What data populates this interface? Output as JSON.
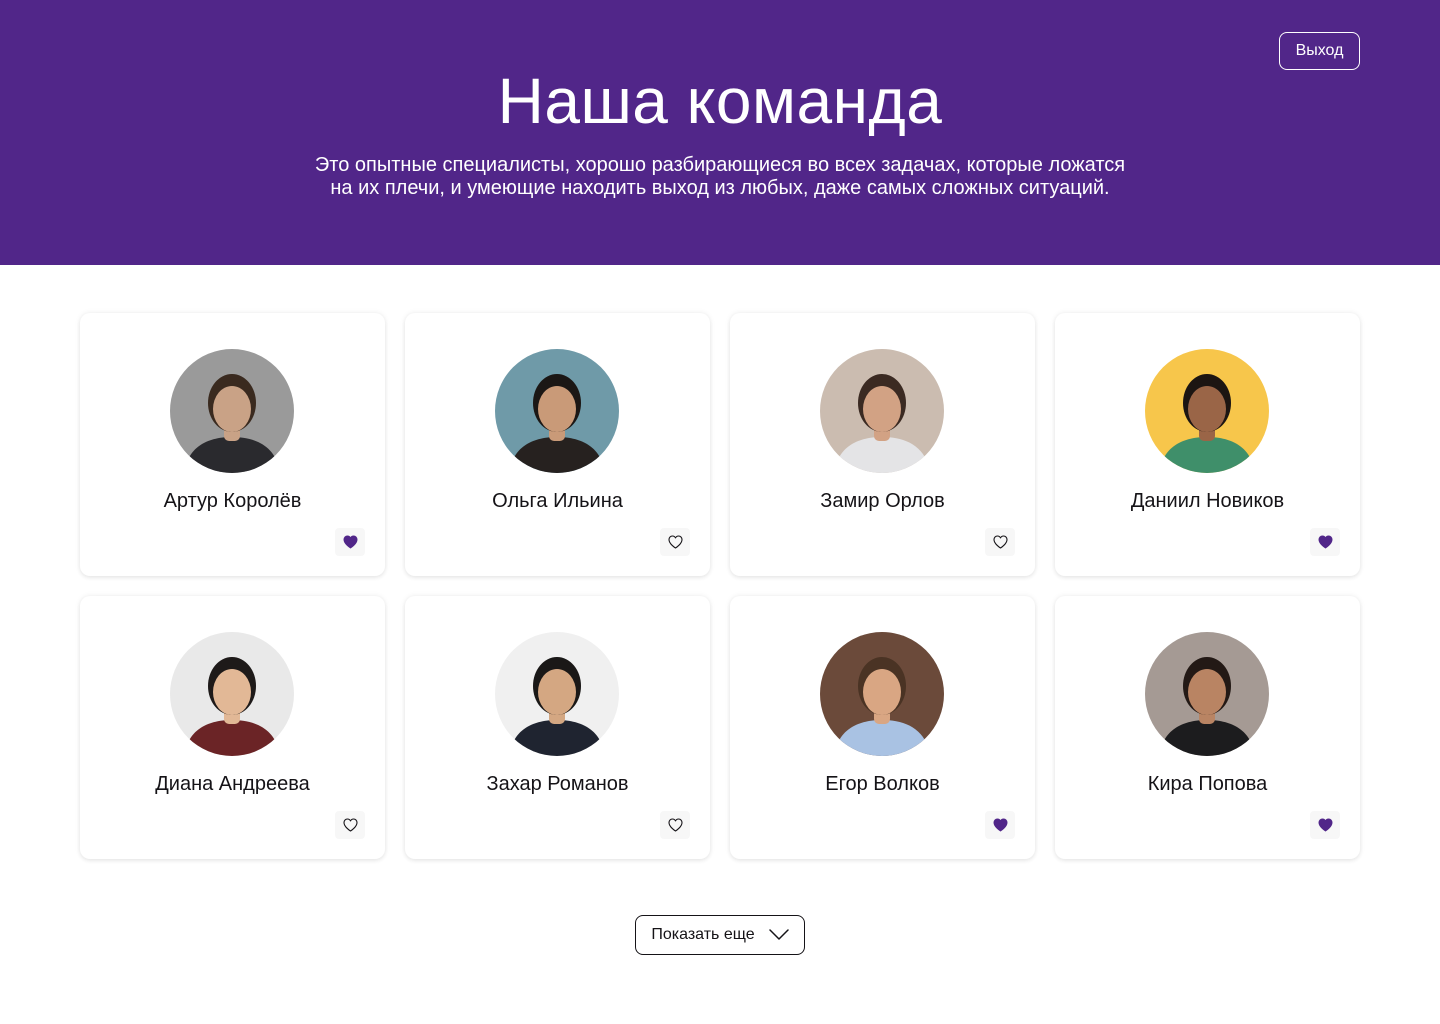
{
  "header": {
    "title": "Наша команда",
    "description_line1": "Это опытные специалисты, хорошо разбирающиеся во всех задачах, которые ложатся",
    "description_line2": "на их плечи, и умеющие находить выход из любых, даже самых сложных ситуаций.",
    "logout_label": "Выход"
  },
  "team": [
    {
      "name": "Артур Королёв",
      "liked": true,
      "avatar_icon": "avatar-photo",
      "avatar_bg": "#9a9a9a",
      "skin": "#c9a286",
      "hair": "#3a2a1f",
      "shirt": "#2a2a2e"
    },
    {
      "name": "Ольга Ильина",
      "liked": false,
      "avatar_icon": "avatar-photo",
      "avatar_bg": "#6f9aa8",
      "skin": "#c99a78",
      "hair": "#1b1715",
      "shirt": "#26211f"
    },
    {
      "name": "Замир Орлов",
      "liked": false,
      "avatar_icon": "avatar-photo",
      "avatar_bg": "#cbbcb0",
      "skin": "#d2a284",
      "hair": "#3b2a22",
      "shirt": "#e4e4e6"
    },
    {
      "name": "Даниил Новиков",
      "liked": true,
      "avatar_icon": "avatar-photo",
      "avatar_bg": "#f7c64b",
      "skin": "#9a6547",
      "hair": "#1c1512",
      "shirt": "#3f8f6a"
    },
    {
      "name": "Диана Андреева",
      "liked": false,
      "avatar_icon": "avatar-photo",
      "avatar_bg": "#e9e9e9",
      "skin": "#e2b896",
      "hair": "#1e1a19",
      "shirt": "#6b2426"
    },
    {
      "name": "Захар Романов",
      "liked": false,
      "avatar_icon": "avatar-photo",
      "avatar_bg": "#f0f0f0",
      "skin": "#d4a782",
      "hair": "#1a1817",
      "shirt": "#1f2430"
    },
    {
      "name": "Егор Волков",
      "liked": true,
      "avatar_icon": "avatar-photo",
      "avatar_bg": "#6b4a3a",
      "skin": "#d9a683",
      "hair": "#4a3324",
      "shirt": "#a9c2e3"
    },
    {
      "name": "Кира Попова",
      "liked": true,
      "avatar_icon": "avatar-photo",
      "avatar_bg": "#a59a94",
      "skin": "#b98463",
      "hair": "#231915",
      "shirt": "#1c1c1e"
    }
  ],
  "show_more_label": "Показать еще",
  "colors": {
    "accent": "#512689",
    "like_fill": "#512689",
    "text": "#151317"
  }
}
